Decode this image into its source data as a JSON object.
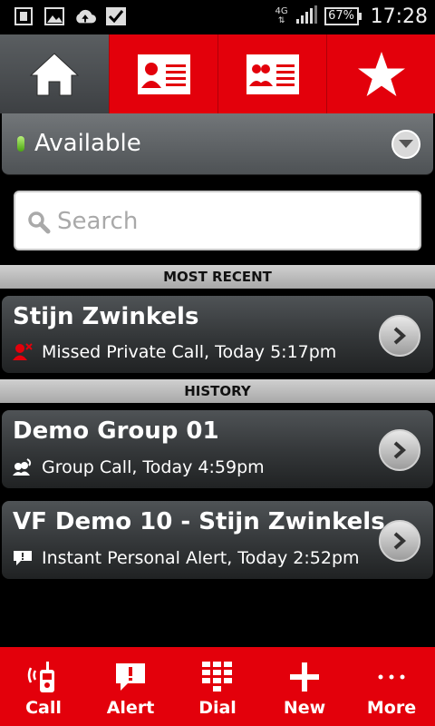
{
  "status_bar": {
    "network_type": "4G",
    "battery_percent": "67%",
    "time": "17:28",
    "left_icons": [
      "sim-icon",
      "image-icon",
      "upload-icon",
      "check-icon"
    ]
  },
  "top_tabs": [
    {
      "icon": "home-icon",
      "active": true
    },
    {
      "icon": "contact-card-icon",
      "active": false
    },
    {
      "icon": "group-card-icon",
      "active": false
    },
    {
      "icon": "star-icon",
      "active": false
    }
  ],
  "presence": {
    "status": "Available"
  },
  "search": {
    "placeholder": "Search"
  },
  "sections": {
    "most_recent": "MOST RECENT",
    "history": "HISTORY"
  },
  "most_recent": [
    {
      "title": "Stijn Zwinkels",
      "subtitle": "Missed Private Call, Today 5:17pm",
      "icon": "missed-call-icon"
    }
  ],
  "history": [
    {
      "title": "Demo Group 01",
      "subtitle": "Group Call, Today 4:59pm",
      "icon": "group-call-icon"
    },
    {
      "title": "VF Demo 10 - Stijn Zwinkels",
      "subtitle": "Instant Personal Alert, Today 2:52pm",
      "icon": "alert-message-icon"
    }
  ],
  "bottom_bar": [
    {
      "label": "Call",
      "icon": "walkie-talkie-icon"
    },
    {
      "label": "Alert",
      "icon": "alert-bubble-icon"
    },
    {
      "label": "Dial",
      "icon": "dialpad-icon"
    },
    {
      "label": "New",
      "icon": "plus-icon"
    },
    {
      "label": "More",
      "icon": "more-dots-icon"
    }
  ],
  "colors": {
    "brand_red": "#e3000b",
    "presence_green": "#4aa510"
  }
}
